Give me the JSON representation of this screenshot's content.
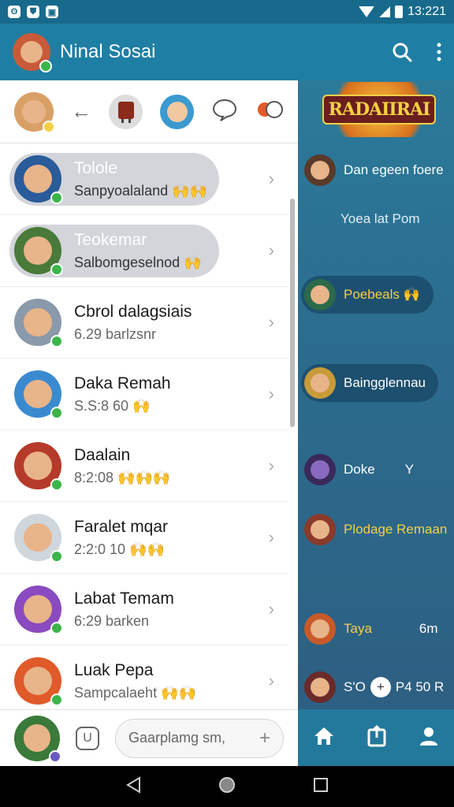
{
  "status_bar": {
    "time": "13:221",
    "left_icons": [
      "notification-icon",
      "shield-icon",
      "app-icon"
    ]
  },
  "app_bar": {
    "title": "Ninal Sosai"
  },
  "stories": {
    "items": [
      "story-1",
      "story-2",
      "story-3",
      "story-4",
      "story-5"
    ]
  },
  "chats": [
    {
      "name": "Tolole",
      "sub": "Sanpyoalaland 🙌🙌",
      "highlight": true,
      "color": "#2a5b9a"
    },
    {
      "name": "Teokemar",
      "sub": "Salbomgeselnod 🙌",
      "highlight": true,
      "color": "#4a7a3a"
    },
    {
      "name": "Cbrol dalagsiais",
      "sub": "6.29 barlzsnr",
      "highlight": false,
      "color": "#8a9aaa"
    },
    {
      "name": "Daka Remah",
      "sub": "S.S:8 60 🙌",
      "highlight": false,
      "color": "#3a8ad0"
    },
    {
      "name": "Daalain",
      "sub": "8:2:08 🙌🙌🙌",
      "highlight": false,
      "color": "#b53a2a"
    },
    {
      "name": "Faralet mqar",
      "sub": "2:2:0 10 🙌🙌",
      "highlight": false,
      "color": "#cfd6dc"
    },
    {
      "name": "Labat Temam",
      "sub": "6:29 barken",
      "highlight": false,
      "color": "#8a4ac0"
    },
    {
      "name": "Luak Pepa",
      "sub": "Sampcalaeht 🙌🙌",
      "highlight": false,
      "color": "#e05a2a"
    }
  ],
  "compose": {
    "placeholder": "Gaarplamg sm,",
    "sticker_label": "U"
  },
  "game_panel": {
    "logo_text": "RADAIIRAI",
    "rows": [
      {
        "label": "Dan egeen foere"
      },
      {
        "label": "Yoea lat Pom"
      },
      {
        "label": "Poebeals 🙌"
      },
      {
        "label": "Baingglennau"
      },
      {
        "label": "Doke"
      },
      {
        "label": "Plodage Remaan"
      },
      {
        "label": "Taya"
      },
      {
        "label": "P4 50 R"
      }
    ],
    "side_labels": [
      "6m",
      "S'O",
      "Y"
    ]
  },
  "colors": {
    "accent": "#1f7ea3",
    "online": "#3bb54a",
    "yellow": "#f3d045"
  }
}
